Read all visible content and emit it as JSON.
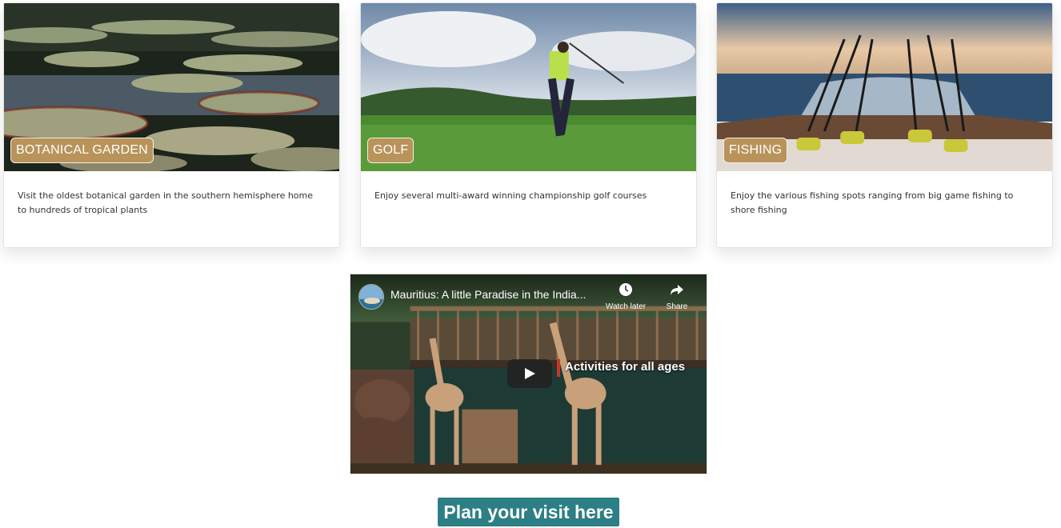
{
  "cards": [
    {
      "badge": "BOTANICAL GARDEN",
      "description": "Visit the oldest botanical garden in the southern hemisphere home to hundreds of tropical plants"
    },
    {
      "badge": "GOLF",
      "description": "Enjoy several multi-award winning championship golf courses"
    },
    {
      "badge": "FISHING",
      "description": "Enjoy the various fishing spots ranging from big game fishing to shore fishing"
    }
  ],
  "video": {
    "title": "Mauritius: A little Paradise in the India...",
    "watch_later_label": "Watch later",
    "share_label": "Share",
    "caption": "Activities for all ages"
  },
  "cta": {
    "label": "Plan your visit here"
  },
  "colors": {
    "badge_bg": "#b8935a",
    "cta_bg": "#2c7f84"
  }
}
